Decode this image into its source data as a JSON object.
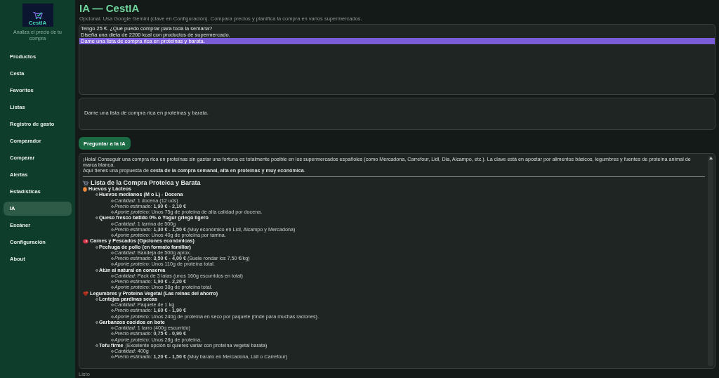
{
  "sidebar": {
    "logo_text": "CestIA",
    "tagline": "Analiza el precio de tu compra",
    "items": [
      {
        "label": "Productos",
        "selected": false
      },
      {
        "label": "Cesta",
        "selected": false
      },
      {
        "label": "Favoritos",
        "selected": false
      },
      {
        "label": "Listas",
        "selected": false
      },
      {
        "label": "Registro de gasto",
        "selected": false
      },
      {
        "label": "Comparador",
        "selected": false
      },
      {
        "label": "Comparar",
        "selected": false
      },
      {
        "label": "Alertas",
        "selected": false
      },
      {
        "label": "Estadísticas",
        "selected": false
      },
      {
        "label": "IA",
        "selected": true
      },
      {
        "label": "Escáner",
        "selected": false
      },
      {
        "label": "Configuración",
        "selected": false
      },
      {
        "label": "About",
        "selected": false
      }
    ]
  },
  "page": {
    "title": "IA — CestIA",
    "subtitle": "Opcional. Usa Google Gemini (clave en Configuración). Compara precios y planifica la compra en varios supermercados."
  },
  "suggestions": [
    {
      "text": "Tengo 25 €. ¿Qué puedo comprar para toda la semana?",
      "selected": false
    },
    {
      "text": "Diseña una dieta de 2200 kcal con productos de supermercado.",
      "selected": false
    },
    {
      "text": "Dame una lista de compra rica en proteínas y barata.",
      "selected": true
    }
  ],
  "prompt": {
    "value": "Dame una lista de compra rica en proteínas y barata."
  },
  "ask_button": "Preguntar a la IA",
  "response": {
    "intro": [
      "¡Hola! Conseguir una compra rica en proteínas sin gastar una fortuna es totalmente posible en los supermercados españoles (como Mercadona, Carrefour, Lidl, Dia, Alcampo, etc.). La clave está en apostar por alimentos básicos, legumbres y fuentes de proteína animal de marca blanca.",
      "Aquí tienes una propuesta de **cesta de la compra semanal, alta en proteínas y muy económica**."
    ],
    "heading": "Lista de la Compra Proteica y Barata",
    "sections": [
      {
        "kind": "egg",
        "title": "Huevos y Lácteos",
        "items": [
          {
            "name": "Huevos medianos (M o L) - Docena",
            "details": [
              "*Cantidad:* 1 docena (12 uds)",
              "*Precio estimado:* **1,90 € - 2,10 €**",
              "*Aporte proteico:* Unos 75g de proteína de alta calidad por docena."
            ]
          },
          {
            "name": "Queso fresco batido 0% o Yogur griego ligero",
            "details": [
              "*Cantidad:* 1 tarrina de 500g",
              "*Precio estimado:* **1,30 € - 1,50 €** (Muy económico en Lidl, Alcampo y Mercadona)",
              "*Aporte proteico:* Unos 40g de proteína por tarrina."
            ]
          }
        ]
      },
      {
        "kind": "meat",
        "title": "Carnes y Pescados (Opciones económicas)",
        "items": [
          {
            "name": "Pechuga de pollo (en formato familiar)",
            "details": [
              "*Cantidad:* Bandeja de 500g aprox.",
              "*Precio estimado:* **3,50 € - 4,00 €** (Suele rondar los 7,50 €/kg)",
              "*Aporte proteico:* Unos 110g de proteína total."
            ]
          },
          {
            "name": "Atún al natural en conserva",
            "details": [
              "*Cantidad:* Pack de 3 latas (unos 160g escurridos en total)",
              "*Precio estimado:* **1,90 € - 2,20 €**",
              "*Aporte proteico:* Unos 38g de proteína total."
            ]
          }
        ]
      },
      {
        "kind": "beans",
        "title": "Legumbres y Proteína Vegetal (Las reinas del ahorro)",
        "items": [
          {
            "name": "Lentejas pardinas secas",
            "details": [
              "*Cantidad:* Paquete de 1 kg",
              "*Precio estimado:* **1,60 € - 1,90 €**",
              "*Aporte proteico:* Unos 240g de proteína en seco por paquete (rinde para muchas raciones)."
            ]
          },
          {
            "name": "Garbanzos cocidos en bote",
            "details": [
              "*Cantidad:* 1 tarro (400g escurrido)",
              "*Precio estimado:* **0,75 € - 0,90 €**",
              "*Aporte proteico:* Unos 28g de proteína."
            ]
          },
          {
            "name": "Tofu firme",
            "note": "(Excelente opción si quieres variar con proteína vegetal barata)",
            "details": [
              "*Cantidad:* 400g",
              "*Precio estimado:* **1,20 € - 1,50 €** (Muy barato en Mercadona, Lidl o Carrefour)"
            ]
          }
        ]
      }
    ]
  },
  "status_bar": "Listo"
}
